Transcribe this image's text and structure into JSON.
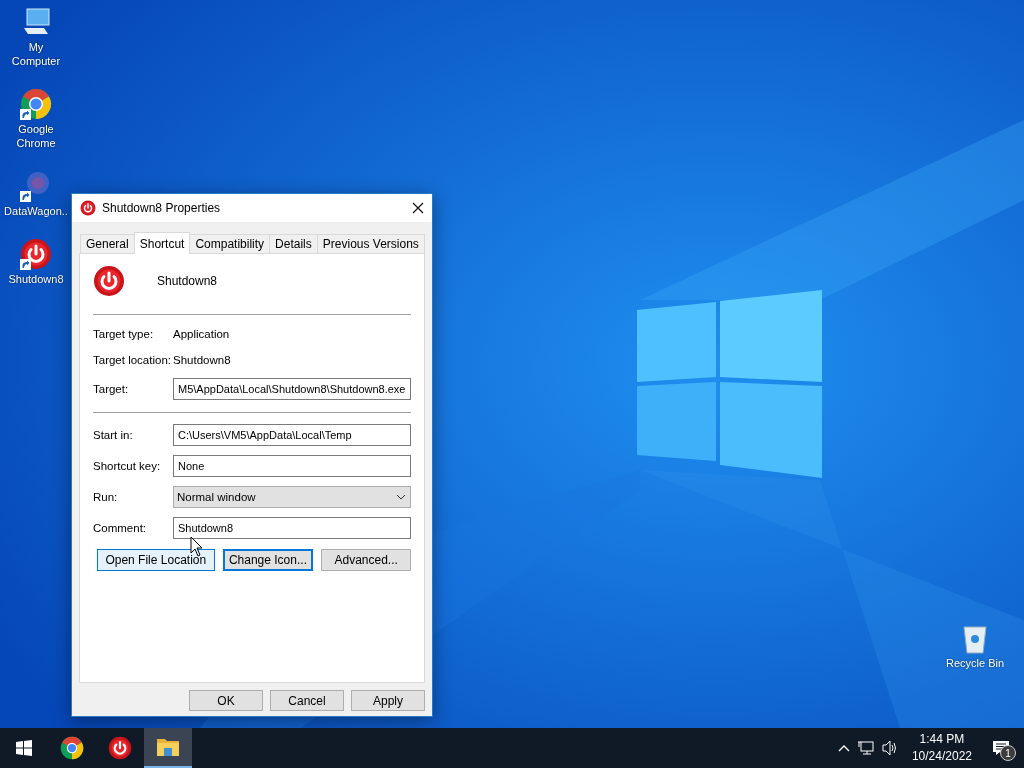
{
  "desktop_icons": [
    {
      "label": "My Computer",
      "kind": "computer",
      "shortcut": false
    },
    {
      "label": "Google Chrome",
      "kind": "chrome",
      "shortcut": true
    },
    {
      "label": "DataWagon..",
      "kind": "datawagon",
      "shortcut": true
    },
    {
      "label": "Shutdown8",
      "kind": "power",
      "shortcut": true
    }
  ],
  "recycle_bin": {
    "label": "Recycle Bin"
  },
  "dialog": {
    "title": "Shutdown8 Properties",
    "tabs": [
      {
        "label": "General",
        "selected": false
      },
      {
        "label": "Shortcut",
        "selected": true
      },
      {
        "label": "Compatibility",
        "selected": false
      },
      {
        "label": "Details",
        "selected": false
      },
      {
        "label": "Previous Versions",
        "selected": false
      }
    ],
    "app_name": "Shutdown8",
    "rows": [
      {
        "kind": "separator"
      },
      {
        "kind": "static",
        "label": "Target type:",
        "value": "Application"
      },
      {
        "kind": "static",
        "label": "Target location:",
        "value": "Shutdown8"
      },
      {
        "kind": "field",
        "label": "Target:",
        "value": "M5\\AppData\\Local\\Shutdown8\\Shutdown8.exe"
      },
      {
        "kind": "separator"
      },
      {
        "kind": "field",
        "label": "Start in:",
        "value": "C:\\Users\\VM5\\AppData\\Local\\Temp"
      },
      {
        "kind": "field",
        "label": "Shortcut key:",
        "value": "None"
      },
      {
        "kind": "dropdown",
        "label": "Run:",
        "value": "Normal window"
      },
      {
        "kind": "field",
        "label": "Comment:",
        "value": "Shutdown8"
      }
    ],
    "actions": [
      {
        "label": "Open File Location",
        "hovered": true,
        "focused": false
      },
      {
        "label": "Change Icon...",
        "hovered": false,
        "focused": true
      },
      {
        "label": "Advanced...",
        "hovered": false,
        "focused": false
      }
    ],
    "buttons": [
      "OK",
      "Cancel",
      "Apply"
    ]
  },
  "taskbar": {
    "apps": [
      {
        "kind": "chrome",
        "selected": false
      },
      {
        "kind": "power",
        "selected": false
      },
      {
        "kind": "folder",
        "selected": true
      }
    ],
    "time": "1:44 PM",
    "date": "10/24/2022",
    "notifications": "1"
  }
}
